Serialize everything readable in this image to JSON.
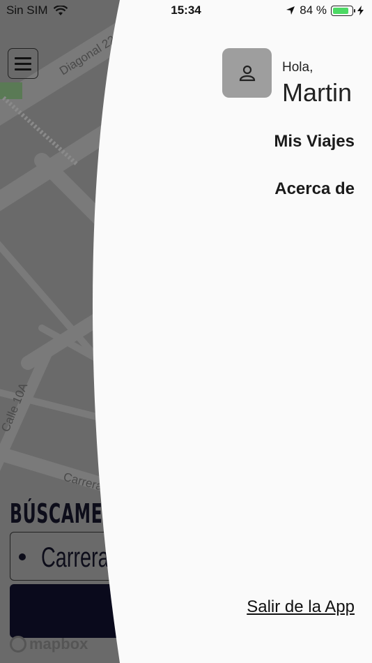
{
  "status_bar": {
    "carrier": "Sin SIM",
    "time": "15:34",
    "battery_percent": "84 %",
    "battery_level": 0.84,
    "icons": [
      "wifi-icon",
      "location-arrow-icon",
      "battery-icon",
      "charging-bolt-icon"
    ]
  },
  "map": {
    "street_labels": [
      "Diagonal 22",
      "Calle 10A",
      "Carrera"
    ],
    "attribution": "mapbox"
  },
  "bottom_panel": {
    "title": "BÚSCAME EN",
    "address_value": "Carrera"
  },
  "drawer": {
    "greeting": "Hola,",
    "user_name": "Martin",
    "menu_items": [
      {
        "label": "Mis Viajes"
      },
      {
        "label": "Acerca de"
      }
    ],
    "logout_label": "Salir de la App"
  },
  "colors": {
    "drawer_bg": "#fafafa",
    "avatar_bg": "#9e9e9e",
    "map_overlay": "#6b6b6b",
    "button_dark": "#0a0a1c",
    "battery_green": "#4cd964"
  }
}
